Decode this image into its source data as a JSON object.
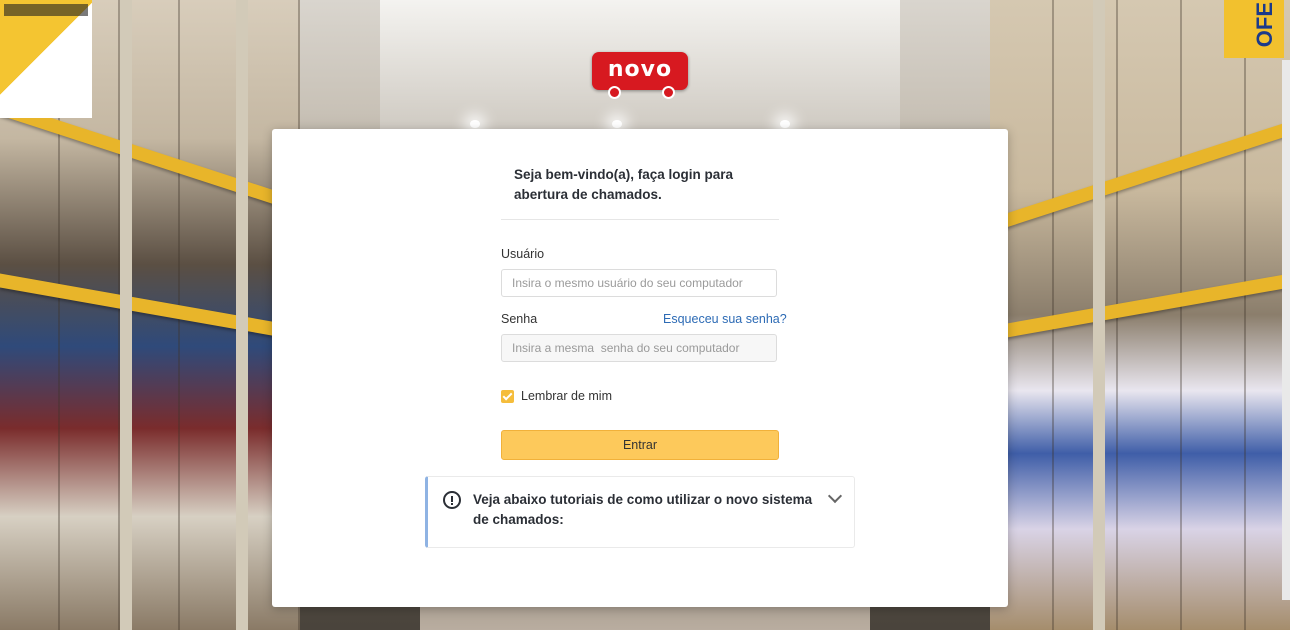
{
  "brand": {
    "logo_text": "novo",
    "accent": "#d71920"
  },
  "signs": {
    "right_sign": "OFE"
  },
  "login": {
    "welcome": "Seja bem-vindo(a), faça login para abertura de chamados.",
    "user_label": "Usuário",
    "user_placeholder": "Insira o mesmo usuário do seu computador",
    "password_label": "Senha",
    "password_placeholder": "Insira a mesma  senha do seu computador",
    "forgot_link": "Esqueceu sua senha?",
    "remember_label": "Lembrar de mim",
    "remember_checked": true,
    "submit_label": "Entrar",
    "submit_color": "#fdc95b"
  },
  "tutorial": {
    "text": "Veja abaixo tutoriais de como utilizar o novo sistema de chamados:",
    "icon": "info-circle-icon",
    "toggle_icon": "chevron-down-icon"
  }
}
